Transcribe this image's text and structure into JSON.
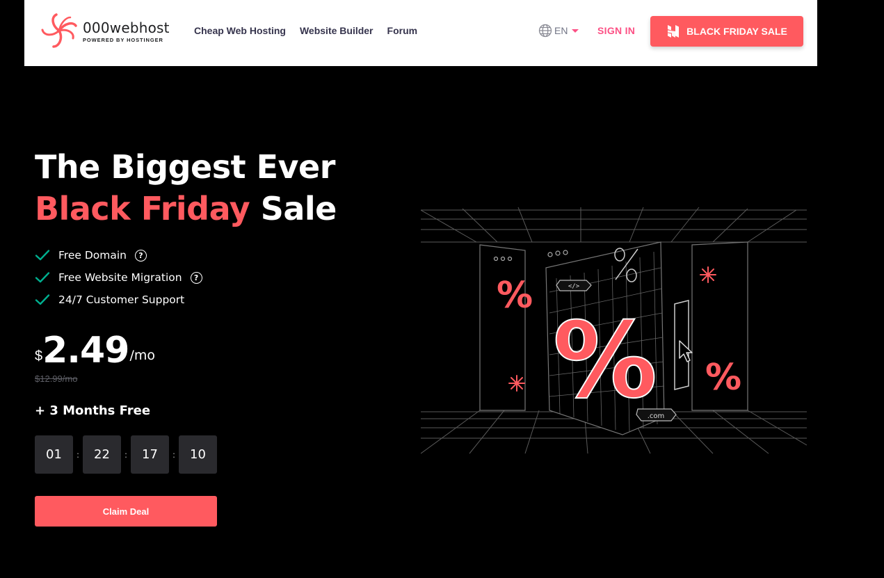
{
  "header": {
    "logo": {
      "name": "000webhost",
      "tagline": "POWERED BY HOSTINGER"
    },
    "nav": [
      "Cheap Web Hosting",
      "Website Builder",
      "Forum"
    ],
    "language": {
      "code": "EN",
      "icon": "globe-icon"
    },
    "signin_label": "SIGN IN",
    "cta_label": "BLACK FRIDAY SALE",
    "cta_icon": "hostinger-logo-icon"
  },
  "hero": {
    "title_line1": "The Biggest Ever",
    "title_line2_accent": "Black Friday",
    "title_line2_rest": " Sale",
    "features": [
      {
        "label": "Free Domain",
        "help": true
      },
      {
        "label": "Free Website Migration",
        "help": true
      },
      {
        "label": "24/7 Customer Support",
        "help": false
      }
    ],
    "price": {
      "currency": "$",
      "amount": "2.49",
      "period": "/mo",
      "old": "$12.99/mo"
    },
    "bonus": "+ 3 Months Free",
    "countdown": [
      "01",
      "22",
      "17",
      "10"
    ],
    "countdown_separator": ":",
    "claim_label": "Claim Deal"
  },
  "illustration": {
    "tags": {
      "code": "</>",
      "domain": ".com"
    },
    "symbol": "%"
  },
  "colors": {
    "accent": "#ff5a5f",
    "pink": "#fc5185",
    "check": "#00b090",
    "background": "#000000"
  }
}
